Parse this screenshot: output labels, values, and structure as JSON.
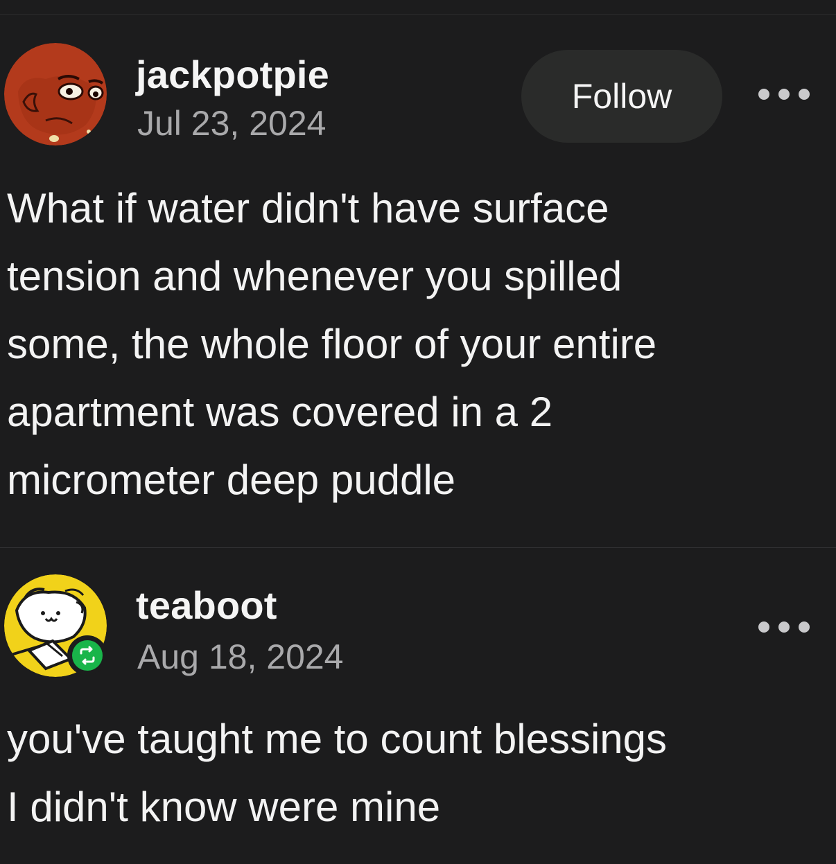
{
  "posts": [
    {
      "username": "jackpotpie",
      "date": "Jul 23, 2024",
      "follow_label": "Follow",
      "avatar_icon": "cartoon-face-avatar",
      "more_icon": "ellipsis-icon",
      "body_lines": [
        "What if water didn't have surface",
        "tension and whenever you spilled",
        "some, the whole floor of your entire",
        "apartment was covered in a 2",
        "micrometer deep puddle"
      ]
    },
    {
      "username": "teaboot",
      "date": "Aug 18, 2024",
      "avatar_icon": "cartoon-character-avatar",
      "badge_icon": "reblog-icon",
      "more_icon": "ellipsis-icon",
      "body_lines": [
        "you've taught me to count blessings",
        "I didn't know were mine"
      ]
    }
  ],
  "colors": {
    "background": "#1c1c1d",
    "text": "#f3f3f3",
    "muted": "#a9a9ab",
    "follow_bg": "#2a2b2a",
    "reblog_green": "#19b54a",
    "avatar1_red": "#b33a1c",
    "avatar2_yellow": "#f1d21a"
  }
}
